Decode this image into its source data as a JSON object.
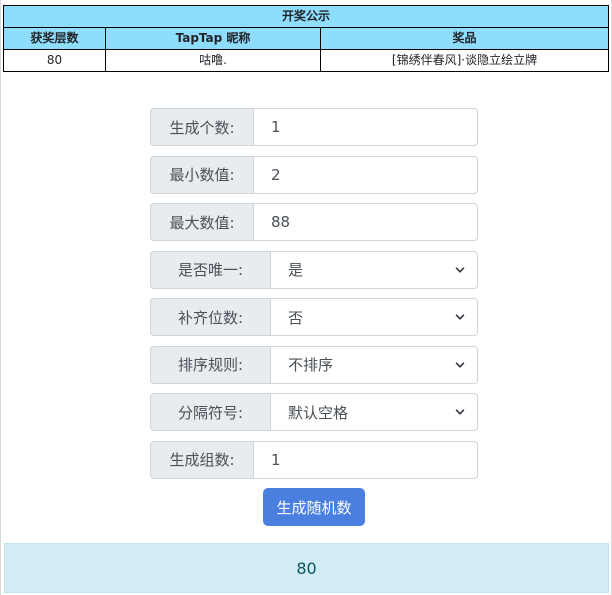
{
  "announcement": {
    "title": "开奖公示",
    "columns": [
      "获奖层数",
      "TapTap 昵称",
      "奖品"
    ],
    "rows": [
      [
        "80",
        "咕噜.",
        "[锦绣伴春风]·谈隐立绘立牌"
      ]
    ]
  },
  "form": {
    "count": {
      "label": "生成个数:",
      "value": "1"
    },
    "min": {
      "label": "最小数值:",
      "value": "2"
    },
    "max": {
      "label": "最大数值:",
      "value": "88"
    },
    "unique": {
      "label": "是否唯一:",
      "selected": "是"
    },
    "pad": {
      "label": "补齐位数:",
      "selected": "否"
    },
    "sort": {
      "label": "排序规则:",
      "selected": "不排序"
    },
    "separator": {
      "label": "分隔符号:",
      "selected": "默认空格"
    },
    "groups": {
      "label": "生成组数:",
      "value": "1"
    },
    "generate_label": "生成随机数"
  },
  "result": {
    "value": "80"
  },
  "colors": {
    "table_header_bg": "#8fddfd",
    "button_bg": "#4a7fe0",
    "result_bg": "#d1ecf4"
  },
  "icons": {
    "select_arrow": "chevron-down-icon"
  }
}
